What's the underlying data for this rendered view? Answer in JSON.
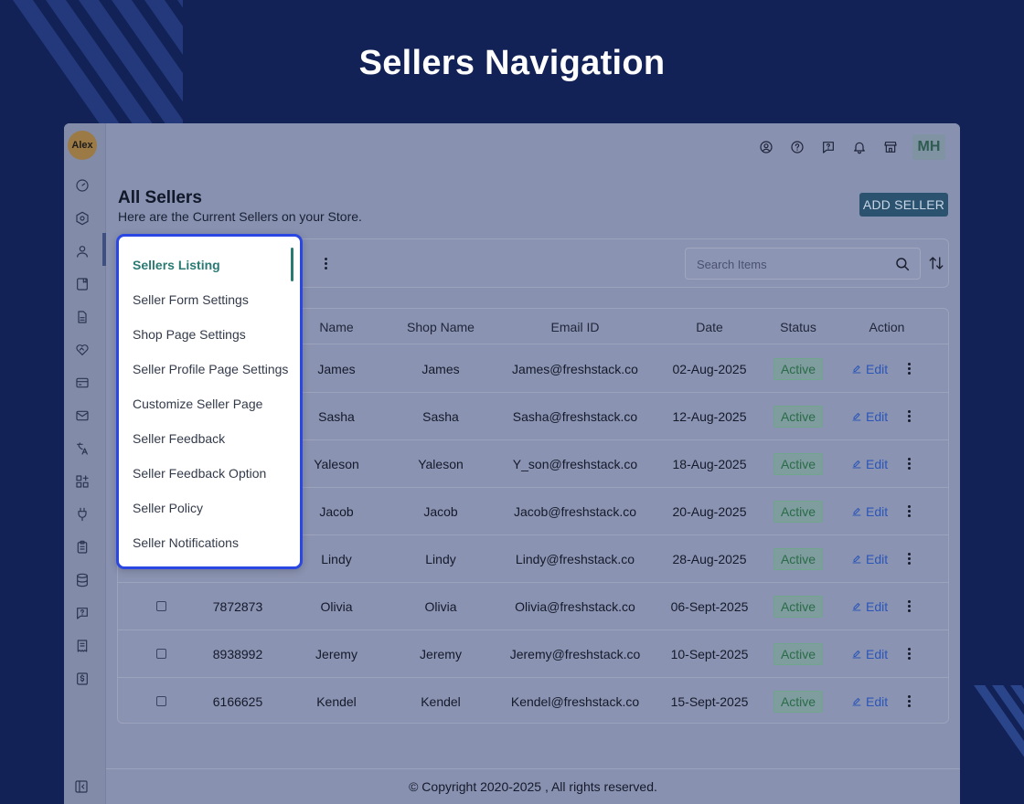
{
  "page": {
    "heading": "Sellers Navigation"
  },
  "rail": {
    "avatar_label": "Alex",
    "icons": [
      "dashboard-icon",
      "hexagon-settings-icon",
      "user-icon",
      "book-icon",
      "file-icon",
      "heart-handshake-icon",
      "credit-card-icon",
      "mail-icon",
      "translate-icon",
      "widgets-icon",
      "plug-icon",
      "clipboard-icon",
      "database-icon",
      "help-chat-icon",
      "receipt-icon",
      "dollar-doc-icon"
    ],
    "collapse_icon": "sidebar-collapse-icon"
  },
  "topbar": {
    "icons": [
      "user-circle-icon",
      "help-circle-icon",
      "message-question-icon",
      "bell-icon",
      "store-icon"
    ],
    "user_initials": "MH"
  },
  "header": {
    "title": "All Sellers",
    "subtitle": "Here are the Current Sellers on your Store.",
    "add_button": "ADD SELLER"
  },
  "search": {
    "placeholder": "Search Items"
  },
  "table": {
    "columns": [
      "Name",
      "Shop Name",
      "Email ID",
      "Date",
      "Status",
      "Action"
    ],
    "edit_label": "Edit",
    "rows": [
      {
        "id": "",
        "name": "James",
        "shop": "James",
        "email": "James@freshstack.co",
        "date": "02-Aug-2025",
        "status": "Active"
      },
      {
        "id": "",
        "name": "Sasha",
        "shop": "Sasha",
        "email": "Sasha@freshstack.co",
        "date": "12-Aug-2025",
        "status": "Active"
      },
      {
        "id": "",
        "name": "Yaleson",
        "shop": "Yaleson",
        "email": "Y_son@freshstack.co",
        "date": "18-Aug-2025",
        "status": "Active"
      },
      {
        "id": "",
        "name": "Jacob",
        "shop": "Jacob",
        "email": "Jacob@freshstack.co",
        "date": "20-Aug-2025",
        "status": "Active"
      },
      {
        "id": "",
        "name": "Lindy",
        "shop": "Lindy",
        "email": "Lindy@freshstack.co",
        "date": "28-Aug-2025",
        "status": "Active"
      },
      {
        "id": "7872873",
        "name": "Olivia",
        "shop": "Olivia",
        "email": "Olivia@freshstack.co",
        "date": "06-Sept-2025",
        "status": "Active"
      },
      {
        "id": "8938992",
        "name": "Jeremy",
        "shop": "Jeremy",
        "email": "Jeremy@freshstack.co",
        "date": "10-Sept-2025",
        "status": "Active"
      },
      {
        "id": "6166625",
        "name": "Kendel",
        "shop": "Kendel",
        "email": "Kendel@freshstack.co",
        "date": "15-Sept-2025",
        "status": "Active"
      }
    ]
  },
  "menu": {
    "items": [
      "Sellers Listing",
      "Seller Form Settings",
      "Shop Page Settings",
      "Seller Profile Page Settings",
      "Customize Seller Page",
      "Seller Feedback",
      "Seller Feedback Option",
      "Seller Policy",
      "Seller Notifications"
    ],
    "active_index": 0,
    "highlight_color": "#2b47e3",
    "active_color": "#2a7a74"
  },
  "footer": {
    "copyright": "© Copyright 2020-2025 , All rights reserved."
  }
}
